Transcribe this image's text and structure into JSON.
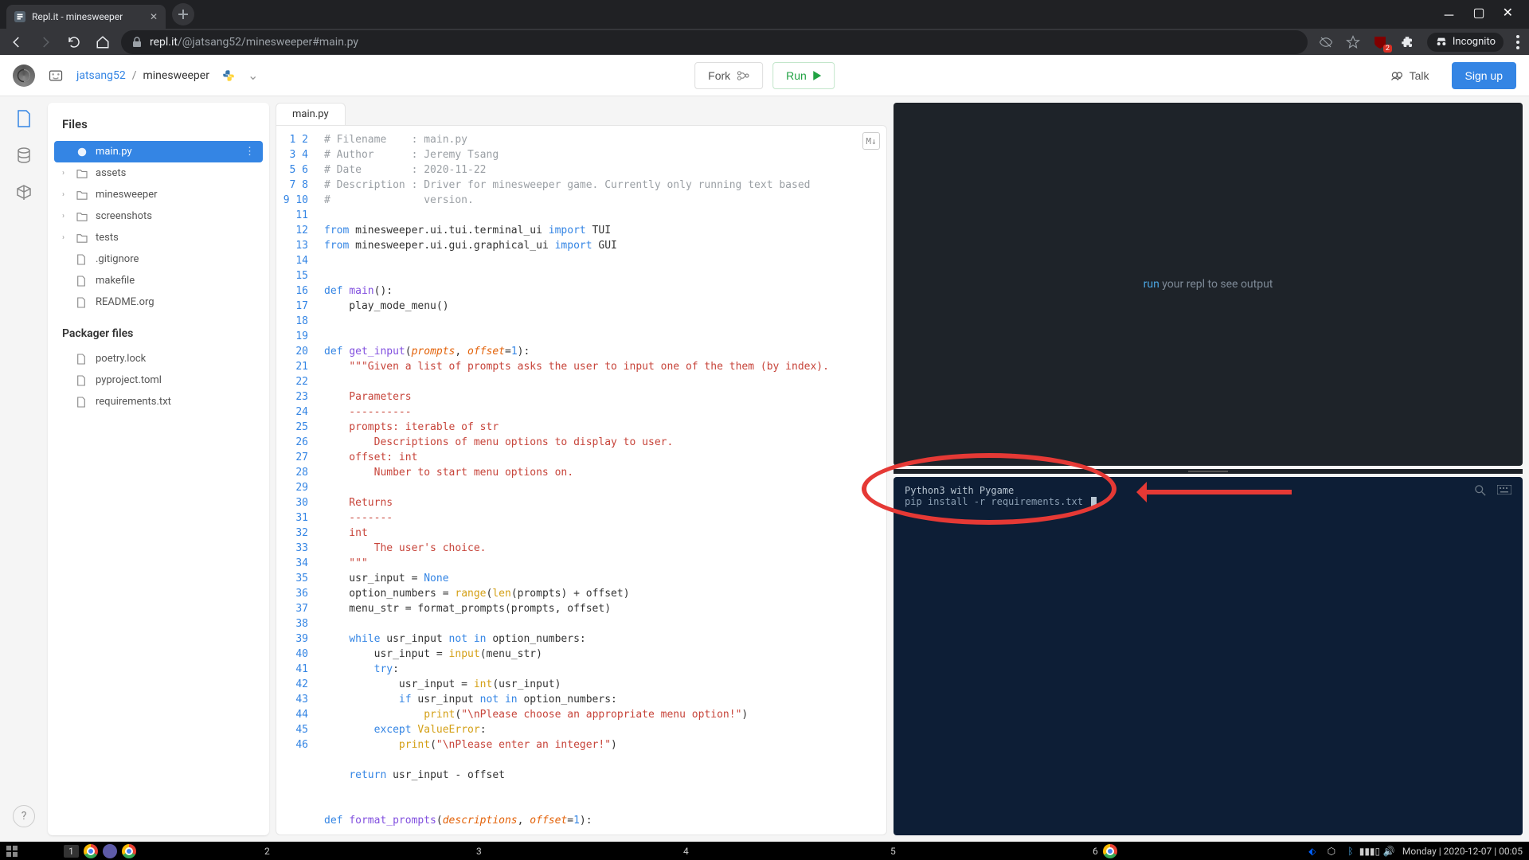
{
  "browser": {
    "tab_title": "Repl.it - minesweeper",
    "url_host": "repl.it",
    "url_path": "/@jatsang52/minesweeper#main.py",
    "incognito_label": "Incognito",
    "ext_count": "2"
  },
  "header": {
    "user": "jatsang52",
    "project": "minesweeper",
    "fork_label": "Fork",
    "run_label": "Run",
    "talk_label": "Talk",
    "signup_label": "Sign up"
  },
  "files": {
    "title": "Files",
    "items": [
      {
        "name": "main.py",
        "type": "python",
        "active": true
      },
      {
        "name": "assets",
        "type": "folder"
      },
      {
        "name": "minesweeper",
        "type": "folder"
      },
      {
        "name": "screenshots",
        "type": "folder"
      },
      {
        "name": "tests",
        "type": "folder"
      },
      {
        "name": ".gitignore",
        "type": "file"
      },
      {
        "name": "makefile",
        "type": "file"
      },
      {
        "name": "README.org",
        "type": "file"
      }
    ],
    "packager_title": "Packager files",
    "packager_items": [
      {
        "name": "poetry.lock",
        "type": "file"
      },
      {
        "name": "pyproject.toml",
        "type": "file"
      },
      {
        "name": "requirements.txt",
        "type": "file"
      }
    ]
  },
  "editor": {
    "tab": "main.py"
  },
  "output": {
    "run_word": "run",
    "rest": " your repl to see output"
  },
  "terminal": {
    "line1": "Python3 with Pygame",
    "prompt": "",
    "command": "pip install -r requirements.txt"
  },
  "taskbar": {
    "workspaces": [
      "1",
      "2",
      "3",
      "4",
      "5",
      "6"
    ],
    "datetime": "Monday | 2020-12-07 | 00:05"
  },
  "help": "?"
}
